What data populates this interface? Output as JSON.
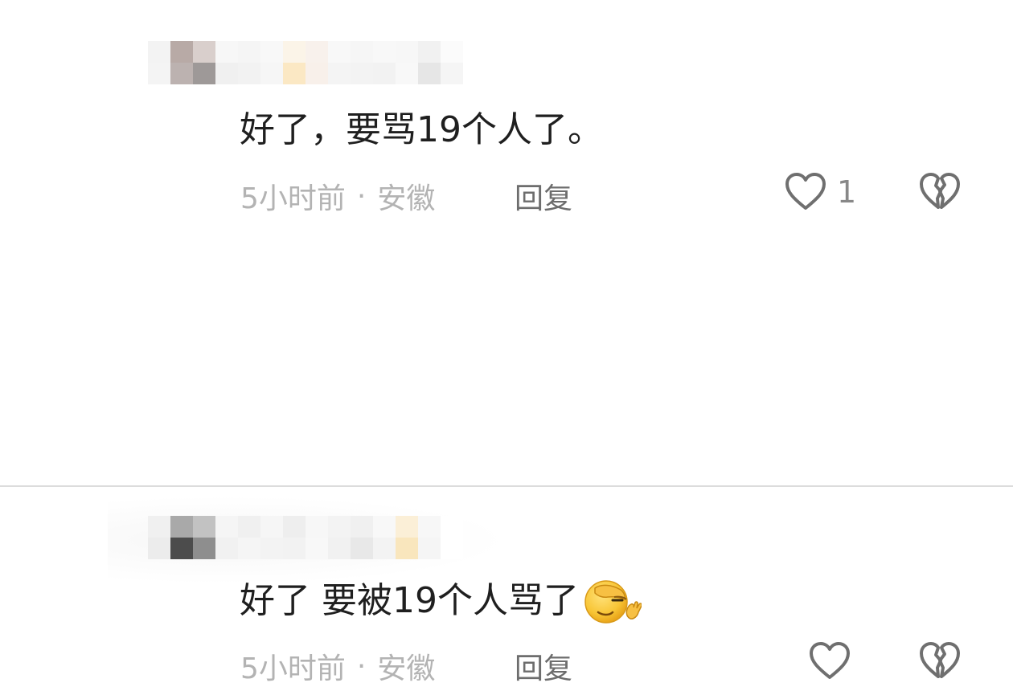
{
  "comments": [
    {
      "text": "好了，要骂19个人了。",
      "time": "5小时前",
      "separator": "·",
      "location": "安徽",
      "reply_label": "回复",
      "like_count": "1",
      "icons": {
        "like": "heart-outline-icon",
        "dislike": "broken-heart-icon"
      },
      "mosaic_colors": [
        "#f3f3f3",
        "#b8aaa6",
        "#d9cfcc",
        "#f7f7f7",
        "#f5f5f5",
        "#f8f8f8",
        "#fbf4e8",
        "#f8f1ec",
        "#f8f8f8",
        "#f6f6f6",
        "#f8f8f8",
        "#f7f7f7",
        "#f1f1f1",
        "#fbfbfb",
        "#f4f4f4",
        "#bcb2b0",
        "#9e9998",
        "#f0f0f0",
        "#f2f2f2",
        "#f6f6f6",
        "#fbe8c4",
        "#f8f0ea",
        "#f4f4f4",
        "#f3f3f3",
        "#f2f2f2",
        "#f8f8f8",
        "#e6e6e6",
        "#f5f5f5"
      ]
    },
    {
      "text": "好了 要被19个人骂了",
      "time": "5小时前",
      "separator": "·",
      "location": "安徽",
      "reply_label": "回复",
      "like_count": "",
      "icons": {
        "like": "heart-outline-icon",
        "dislike": "broken-heart-icon",
        "emoji": "facepalm-emoji-icon"
      },
      "mosaic_colors": [
        "#f0f0f0",
        "#a9a9a9",
        "#c2c2c2",
        "#f5f5f5",
        "#f0f0f0",
        "#f6f6f6",
        "#eeeeee",
        "#f7f7f7",
        "#f3f3f3",
        "#f0f0f0",
        "#f8f8f8",
        "#fbefd7",
        "#f7f7f7",
        "#ffffff",
        "#ececec",
        "#4c4c4c",
        "#8e8e8e",
        "#f1f1f1",
        "#f5f5f5",
        "#f3f3f3",
        "#f2f2f2",
        "#f8f8f8",
        "#f1f1f1",
        "#e8e8e8",
        "#f3f3f3",
        "#f9e6bd",
        "#f5f5f5",
        "#ffffff"
      ]
    }
  ],
  "colors": {
    "text": "#1f1f1f",
    "meta": "#b3b3b3",
    "reply": "#6d6d6d",
    "icon": "#6f6f6f"
  }
}
